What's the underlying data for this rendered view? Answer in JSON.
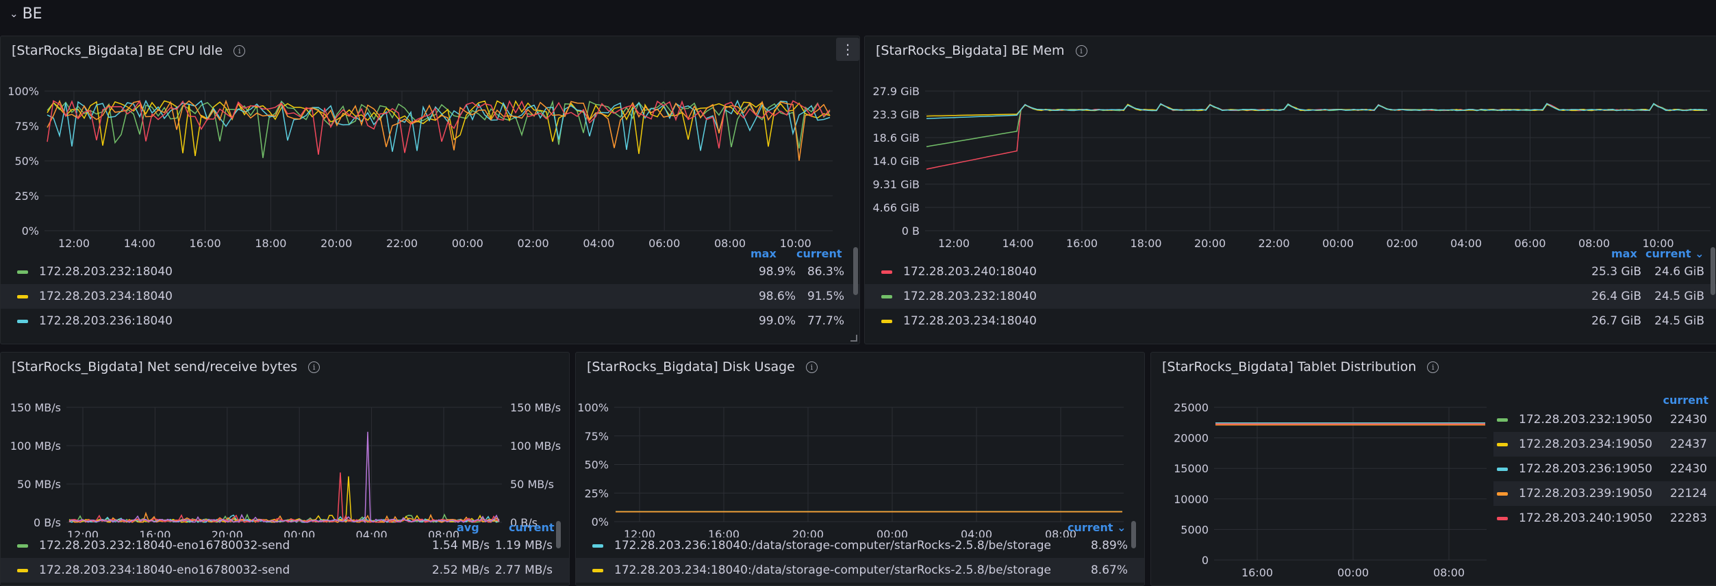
{
  "row": {
    "title": "BE",
    "chevron": "⌄"
  },
  "cpu": {
    "title": "[StarRocks_Bigdata] BE CPU Idle",
    "yticks": [
      "100%",
      "75%",
      "50%",
      "25%",
      "0%"
    ],
    "xticks": [
      "12:00",
      "14:00",
      "16:00",
      "18:00",
      "20:00",
      "22:00",
      "00:00",
      "02:00",
      "04:00",
      "06:00",
      "08:00",
      "10:00"
    ],
    "legend_cols": [
      "max",
      "current"
    ],
    "legend": [
      {
        "name": "172.28.203.232:18040",
        "color": "#73bf69",
        "max": "98.9%",
        "current": "86.3%"
      },
      {
        "name": "172.28.203.234:18040",
        "color": "#f2cc0c",
        "max": "98.6%",
        "current": "91.5%"
      },
      {
        "name": "172.28.203.236:18040",
        "color": "#5dcfe0",
        "max": "99.0%",
        "current": "77.7%"
      }
    ]
  },
  "mem": {
    "title": "[StarRocks_Bigdata] BE Mem",
    "yticks": [
      "27.9 GiB",
      "23.3 GiB",
      "18.6 GiB",
      "14.0 GiB",
      "9.31 GiB",
      "4.66 GiB",
      "0 B"
    ],
    "xticks": [
      "12:00",
      "14:00",
      "16:00",
      "18:00",
      "20:00",
      "22:00",
      "00:00",
      "02:00",
      "04:00",
      "06:00",
      "08:00",
      "10:00"
    ],
    "legend_cols": [
      "max",
      "current ⌄"
    ],
    "legend": [
      {
        "name": "172.28.203.240:18040",
        "color": "#f2495c",
        "max": "25.3 GiB",
        "current": "24.6 GiB"
      },
      {
        "name": "172.28.203.232:18040",
        "color": "#73bf69",
        "max": "26.4 GiB",
        "current": "24.5 GiB"
      },
      {
        "name": "172.28.203.234:18040",
        "color": "#f2cc0c",
        "max": "26.7 GiB",
        "current": "24.5 GiB"
      }
    ]
  },
  "net": {
    "title": "[StarRocks_Bigdata] Net send/receive bytes",
    "yticks": [
      "150 MB/s",
      "100 MB/s",
      "50 MB/s",
      "0 B/s"
    ],
    "xticks": [
      "12:00",
      "16:00",
      "20:00",
      "00:00",
      "04:00",
      "08:00"
    ],
    "legend_cols": [
      "avg",
      "current"
    ],
    "legend": [
      {
        "name": "172.28.203.232:18040-eno16780032-send",
        "color": "#73bf69",
        "avg": "1.54 MB/s",
        "current": "1.19 MB/s"
      },
      {
        "name": "172.28.203.234:18040-eno16780032-send",
        "color": "#f2cc0c",
        "avg": "2.52 MB/s",
        "current": "2.77 MB/s"
      }
    ]
  },
  "disk": {
    "title": "[StarRocks_Bigdata] Disk Usage",
    "yticks": [
      "100%",
      "75%",
      "50%",
      "25%",
      "0%"
    ],
    "xticks": [
      "12:00",
      "16:00",
      "20:00",
      "00:00",
      "04:00",
      "08:00"
    ],
    "legend_cols": [
      "current ⌄"
    ],
    "legend": [
      {
        "name": "172.28.203.236:18040:/data/storage-computer/starRocks-2.5.8/be/storage",
        "color": "#5dcfe0",
        "current": "8.89%"
      },
      {
        "name": "172.28.203.234:18040:/data/storage-computer/starRocks-2.5.8/be/storage",
        "color": "#f2cc0c",
        "current": "8.67%"
      }
    ]
  },
  "tablet": {
    "title": "[StarRocks_Bigdata] Tablet Distribution",
    "yticks": [
      "25000",
      "20000",
      "15000",
      "10000",
      "5000",
      "0"
    ],
    "xticks": [
      "16:00",
      "00:00",
      "08:00"
    ],
    "legend_cols": [
      "current"
    ],
    "legend": [
      {
        "name": "172.28.203.232:19050",
        "color": "#73bf69",
        "current": "22430"
      },
      {
        "name": "172.28.203.234:19050",
        "color": "#f2cc0c",
        "current": "22437"
      },
      {
        "name": "172.28.203.236:19050",
        "color": "#5dcfe0",
        "current": "22430"
      },
      {
        "name": "172.28.203.239:19050",
        "color": "#ff9830",
        "current": "22124"
      },
      {
        "name": "172.28.203.240:19050",
        "color": "#f2495c",
        "current": "22283"
      }
    ]
  },
  "chart_data": [
    {
      "type": "line",
      "title": "[StarRocks_Bigdata] BE CPU Idle",
      "x_range": [
        "11:00",
        "11:00"
      ],
      "ylim": [
        0,
        100
      ],
      "y_unit": "%",
      "series": [
        {
          "name": "172.28.203.232:18040",
          "typical_range": [
            82,
            99
          ],
          "min_dip": 63,
          "current": 86.3
        },
        {
          "name": "172.28.203.234:18040",
          "typical_range": [
            80,
            99
          ],
          "min_dip": 58,
          "current": 91.5
        },
        {
          "name": "172.28.203.236:18040",
          "typical_range": [
            80,
            99
          ],
          "min_dip": 62,
          "current": 77.7
        }
      ]
    },
    {
      "type": "line",
      "title": "[StarRocks_Bigdata] BE Mem",
      "ylim": [
        0,
        27.9
      ],
      "y_unit": "GiB",
      "series": [
        {
          "name": "172.28.203.240:18040",
          "start": 12.3,
          "before_14:00": 16.1,
          "after_14:00": 24.0,
          "current": 24.6
        },
        {
          "name": "172.28.203.232:18040",
          "start": 16.8,
          "before_14:00": 20.0,
          "after_14:00": 24.0,
          "current": 24.5
        },
        {
          "name": "172.28.203.234:18040",
          "start": 22.9,
          "before_14:00": 23.3,
          "after_14:00": 24.0,
          "current": 24.5
        }
      ]
    },
    {
      "type": "line",
      "title": "[StarRocks_Bigdata] Net send/receive bytes",
      "ylim": [
        0,
        150
      ],
      "y_unit": "MB/s",
      "series": [
        {
          "name": "172.28.203.232:18040-eno16780032-send",
          "avg": 1.54,
          "current": 1.19
        },
        {
          "name": "172.28.203.234:18040-eno16780032-send",
          "avg": 2.52,
          "current": 2.77
        }
      ],
      "spikes": [
        {
          "x": "02:30",
          "y": 65
        },
        {
          "x": "04:00",
          "y": 118
        }
      ]
    },
    {
      "type": "line",
      "title": "[StarRocks_Bigdata] Disk Usage",
      "ylim": [
        0,
        100
      ],
      "y_unit": "%",
      "series": [
        {
          "name": "172.28.203.236:18040:/data/storage-computer/starRocks-2.5.8/be/storage",
          "current": 8.89
        },
        {
          "name": "172.28.203.234:18040:/data/storage-computer/starRocks-2.5.8/be/storage",
          "current": 8.67
        }
      ]
    },
    {
      "type": "line",
      "title": "[StarRocks_Bigdata] Tablet Distribution",
      "ylim": [
        0,
        25000
      ],
      "series": [
        {
          "name": "172.28.203.232:19050",
          "current": 22430
        },
        {
          "name": "172.28.203.234:19050",
          "current": 22437
        },
        {
          "name": "172.28.203.236:19050",
          "current": 22430
        },
        {
          "name": "172.28.203.239:19050",
          "current": 22124
        },
        {
          "name": "172.28.203.240:19050",
          "current": 22283
        }
      ]
    }
  ]
}
